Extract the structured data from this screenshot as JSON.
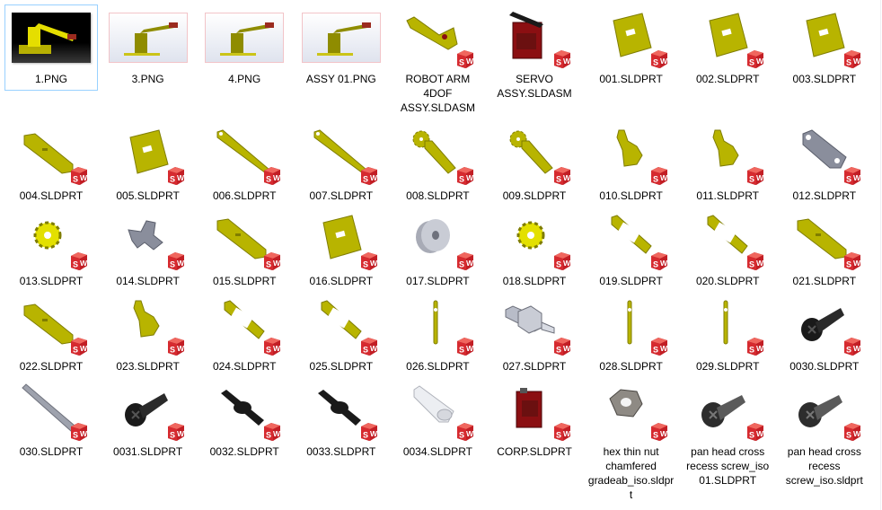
{
  "window": {
    "view": "Large icons",
    "selected_index": 0
  },
  "colors": {
    "selection_border": "#99d1ff",
    "sw_badge": "#d4202a",
    "part_yellow": "#b8b400",
    "part_grey": "#8a8e9c",
    "part_black": "#1a1a1a",
    "servo_red": "#8b0f12"
  },
  "files": [
    {
      "name": "1.PNG",
      "type": "png",
      "icon": "robot-arm-render-dark"
    },
    {
      "name": "3.PNG",
      "type": "png",
      "icon": "robot-arm-render"
    },
    {
      "name": "4.PNG",
      "type": "png",
      "icon": "robot-arm-render"
    },
    {
      "name": "ASSY 01.PNG",
      "type": "png",
      "icon": "robot-arm-render"
    },
    {
      "name": "ROBOT ARM 4DOF ASSY.SLDASM",
      "type": "sldasm",
      "icon": "robot-arm-assembly"
    },
    {
      "name": "SERVO ASSY.SLDASM",
      "type": "sldasm",
      "icon": "servo-assembly"
    },
    {
      "name": "001.SLDPRT",
      "type": "sldprt",
      "icon": "yellow-plate"
    },
    {
      "name": "002.SLDPRT",
      "type": "sldprt",
      "icon": "yellow-plate"
    },
    {
      "name": "003.SLDPRT",
      "type": "sldprt",
      "icon": "yellow-plate"
    },
    {
      "name": "004.SLDPRT",
      "type": "sldprt",
      "icon": "yellow-bar"
    },
    {
      "name": "005.SLDPRT",
      "type": "sldprt",
      "icon": "yellow-plate"
    },
    {
      "name": "006.SLDPRT",
      "type": "sldprt",
      "icon": "yellow-arm"
    },
    {
      "name": "007.SLDPRT",
      "type": "sldprt",
      "icon": "yellow-arm"
    },
    {
      "name": "008.SLDPRT",
      "type": "sldprt",
      "icon": "yellow-gear-arm"
    },
    {
      "name": "009.SLDPRT",
      "type": "sldprt",
      "icon": "yellow-gear-arm"
    },
    {
      "name": "010.SLDPRT",
      "type": "sldprt",
      "icon": "yellow-bracket"
    },
    {
      "name": "011.SLDPRT",
      "type": "sldprt",
      "icon": "yellow-bracket"
    },
    {
      "name": "012.SLDPRT",
      "type": "sldprt",
      "icon": "grey-bracket"
    },
    {
      "name": "013.SLDPRT",
      "type": "sldprt",
      "icon": "yellow-gear"
    },
    {
      "name": "014.SLDPRT",
      "type": "sldprt",
      "icon": "grey-cross"
    },
    {
      "name": "015.SLDPRT",
      "type": "sldprt",
      "icon": "yellow-bar"
    },
    {
      "name": "016.SLDPRT",
      "type": "sldprt",
      "icon": "yellow-plate"
    },
    {
      "name": "017.SLDPRT",
      "type": "sldprt",
      "icon": "grey-spacer"
    },
    {
      "name": "018.SLDPRT",
      "type": "sldprt",
      "icon": "yellow-gear"
    },
    {
      "name": "019.SLDPRT",
      "type": "sldprt",
      "icon": "yellow-frame"
    },
    {
      "name": "020.SLDPRT",
      "type": "sldprt",
      "icon": "yellow-frame"
    },
    {
      "name": "021.SLDPRT",
      "type": "sldprt",
      "icon": "yellow-bar"
    },
    {
      "name": "022.SLDPRT",
      "type": "sldprt",
      "icon": "yellow-bar"
    },
    {
      "name": "023.SLDPRT",
      "type": "sldprt",
      "icon": "yellow-bracket"
    },
    {
      "name": "024.SLDPRT",
      "type": "sldprt",
      "icon": "yellow-frame"
    },
    {
      "name": "025.SLDPRT",
      "type": "sldprt",
      "icon": "yellow-frame"
    },
    {
      "name": "026.SLDPRT",
      "type": "sldprt",
      "icon": "yellow-link"
    },
    {
      "name": "027.SLDPRT",
      "type": "sldprt",
      "icon": "grey-block"
    },
    {
      "name": "028.SLDPRT",
      "type": "sldprt",
      "icon": "yellow-link"
    },
    {
      "name": "029.SLDPRT",
      "type": "sldprt",
      "icon": "yellow-link"
    },
    {
      "name": "0030.SLDPRT",
      "type": "sldprt",
      "icon": "black-screw"
    },
    {
      "name": "030.SLDPRT",
      "type": "sldprt",
      "icon": "grey-shaft"
    },
    {
      "name": "0031.SLDPRT",
      "type": "sldprt",
      "icon": "black-screw"
    },
    {
      "name": "0032.SLDPRT",
      "type": "sldprt",
      "icon": "black-horn"
    },
    {
      "name": "0033.SLDPRT",
      "type": "sldprt",
      "icon": "black-horn"
    },
    {
      "name": "0034.SLDPRT",
      "type": "sldprt",
      "icon": "white-horn"
    },
    {
      "name": "CORP.SLDPRT",
      "type": "sldprt",
      "icon": "servo-body"
    },
    {
      "name": "hex thin nut chamfered gradeab_iso.sldprt",
      "type": "sldprt",
      "icon": "hex-nut"
    },
    {
      "name": "pan head cross recess screw_iso 01.SLDPRT",
      "type": "sldprt",
      "icon": "grey-screw"
    },
    {
      "name": "pan head cross recess screw_iso.sldprt",
      "type": "sldprt",
      "icon": "grey-screw"
    }
  ]
}
